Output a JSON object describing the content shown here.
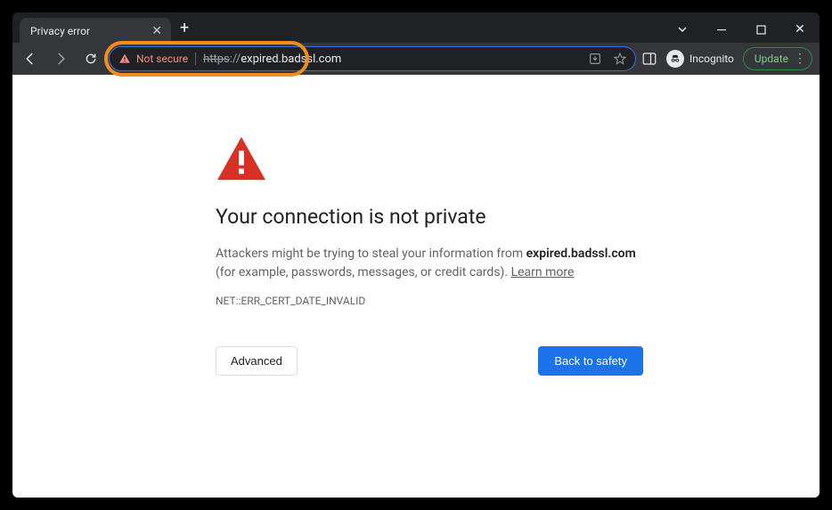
{
  "window": {
    "tab_title": "Privacy error",
    "incognito_label": "Incognito",
    "update_label": "Update"
  },
  "omnibox": {
    "security_label": "Not secure",
    "url_scheme": "https",
    "url_sep": "://",
    "url_host": "expired.badssl.com"
  },
  "page": {
    "heading": "Your connection is not private",
    "body_pre": "Attackers might be trying to steal your information from ",
    "body_host": "expired.badssl.com",
    "body_post": " (for example, passwords, messages, or credit cards). ",
    "learn_more": "Learn more",
    "error_code": "NET::ERR_CERT_DATE_INVALID",
    "advanced_label": "Advanced",
    "safety_label": "Back to safety"
  }
}
